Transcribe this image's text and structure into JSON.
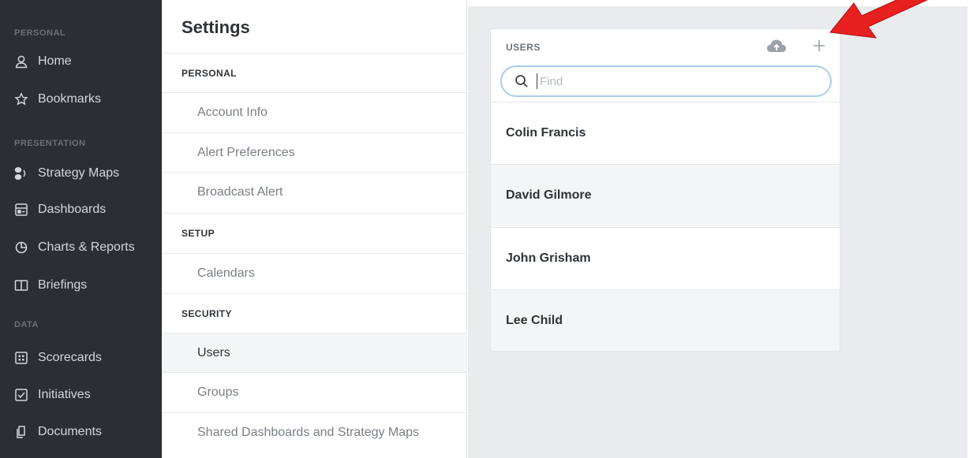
{
  "sidebar": {
    "sections": [
      {
        "label": "PERSONAL"
      },
      {
        "label": "PRESENTATION"
      },
      {
        "label": "DATA"
      }
    ],
    "items": [
      {
        "label": "Home",
        "icon": "person-icon"
      },
      {
        "label": "Bookmarks",
        "icon": "star-icon"
      },
      {
        "label": "Strategy Maps",
        "icon": "strategy-map-icon"
      },
      {
        "label": "Dashboards",
        "icon": "dashboard-icon"
      },
      {
        "label": "Charts & Reports",
        "icon": "pie-chart-icon"
      },
      {
        "label": "Briefings",
        "icon": "book-icon"
      },
      {
        "label": "Scorecards",
        "icon": "scorecard-icon"
      },
      {
        "label": "Initiatives",
        "icon": "checkbox-icon"
      },
      {
        "label": "Documents",
        "icon": "document-icon"
      }
    ]
  },
  "settings": {
    "title": "Settings",
    "groups": [
      {
        "header": "PERSONAL",
        "items": [
          "Account Info",
          "Alert Preferences",
          "Broadcast Alert"
        ]
      },
      {
        "header": "SETUP",
        "items": [
          "Calendars"
        ]
      },
      {
        "header": "SECURITY",
        "items": [
          "Users",
          "Groups",
          "Shared Dashboards and Strategy Maps"
        ]
      }
    ],
    "active_item": "Users"
  },
  "users_panel": {
    "title": "USERS",
    "search": {
      "placeholder": "Find",
      "value": ""
    },
    "users": [
      "Colin Francis",
      "David Gilmore",
      "John Grisham",
      "Lee Child"
    ]
  },
  "colors": {
    "sidebar_bg": "#2b2e33",
    "annotation_arrow": "#e8201f",
    "search_border": "#a9cde6"
  }
}
